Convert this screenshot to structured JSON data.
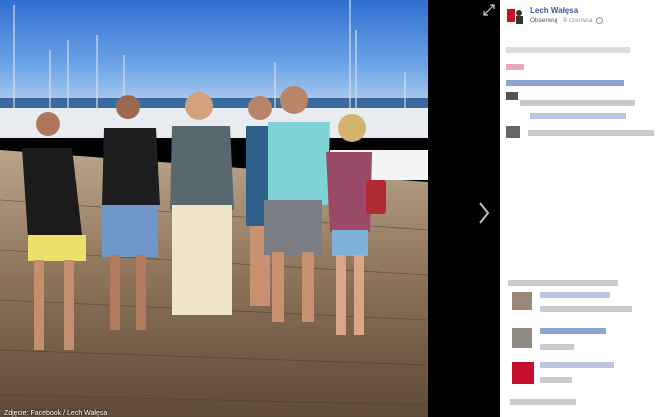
{
  "post": {
    "author": "Lech Wałęsa",
    "follow_label": "Obserwuj",
    "separator": "·",
    "date": "8 czerwca"
  },
  "photo": {
    "caption": "Zdjęcie: Facebook / Lech Wałęsa"
  },
  "icons": {
    "expand": "expand-icon",
    "next": "chevron-right-icon",
    "audience": "globe-icon"
  },
  "colors": {
    "link": "#365899",
    "meta": "#90949c",
    "panel_bg": "#ffffff",
    "viewer_bg": "#000000",
    "blur_gray": "#c9cbd1",
    "blur_blue": "#8aa3cf"
  }
}
